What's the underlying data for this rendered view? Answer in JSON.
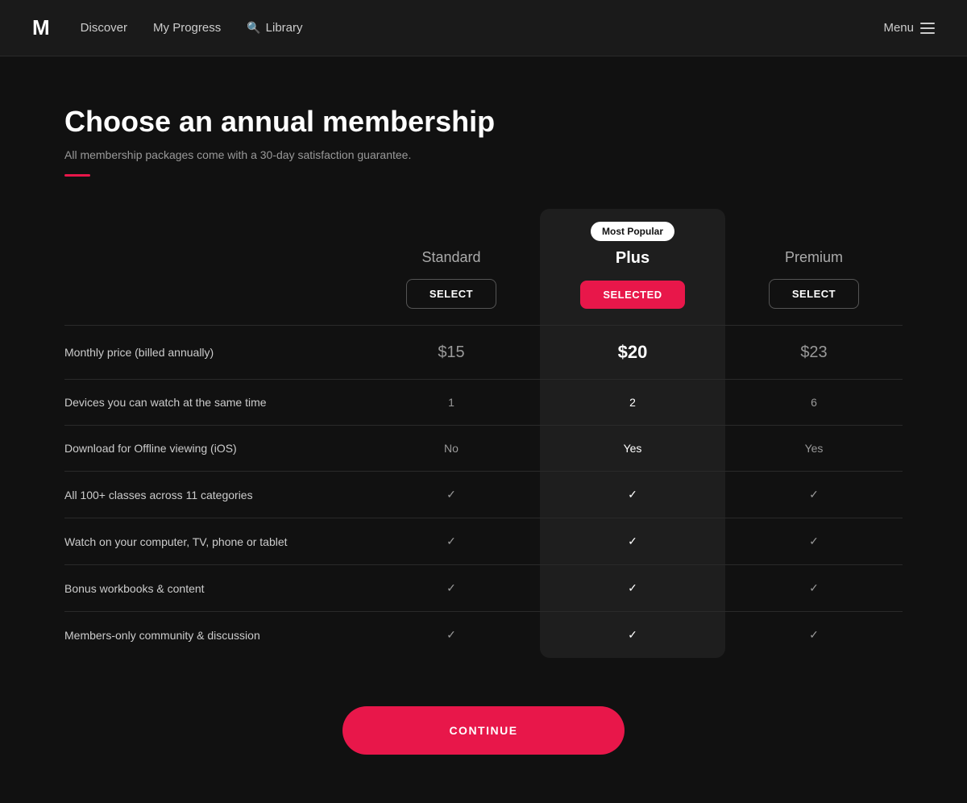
{
  "nav": {
    "logo": "M",
    "links": [
      {
        "label": "Discover",
        "id": "discover"
      },
      {
        "label": "My Progress",
        "id": "my-progress"
      },
      {
        "label": "Library",
        "id": "library",
        "hasIcon": true
      }
    ],
    "menu_label": "Menu"
  },
  "page": {
    "title": "Choose an annual membership",
    "subtitle": "All membership packages come with a 30-day satisfaction guarantee."
  },
  "plans": {
    "most_popular_badge": "Most Popular",
    "standard": {
      "name": "Standard",
      "select_label": "SELECT",
      "is_selected": false
    },
    "plus": {
      "name": "Plus",
      "select_label": "SELECTED",
      "is_selected": true
    },
    "premium": {
      "name": "Premium",
      "select_label": "SELECT",
      "is_selected": false
    }
  },
  "features": [
    {
      "label": "Monthly price (billed annually)",
      "standard": "$15",
      "plus": "$20",
      "premium": "$23",
      "type": "price"
    },
    {
      "label": "Devices you can watch at the same time",
      "standard": "1",
      "plus": "2",
      "premium": "6",
      "type": "number"
    },
    {
      "label": "Download for Offline viewing (iOS)",
      "standard": "No",
      "plus": "Yes",
      "premium": "Yes",
      "type": "text"
    },
    {
      "label": "All 100+ classes across 11 categories",
      "standard": "✓",
      "plus": "✓",
      "premium": "✓",
      "type": "check"
    },
    {
      "label": "Watch on your computer, TV, phone or tablet",
      "standard": "✓",
      "plus": "✓",
      "premium": "✓",
      "type": "check"
    },
    {
      "label": "Bonus workbooks & content",
      "standard": "✓",
      "plus": "✓",
      "premium": "✓",
      "type": "check"
    },
    {
      "label": "Members-only community & discussion",
      "standard": "✓",
      "plus": "✓",
      "premium": "✓",
      "type": "check"
    }
  ],
  "continue_btn": "CONTINUE"
}
